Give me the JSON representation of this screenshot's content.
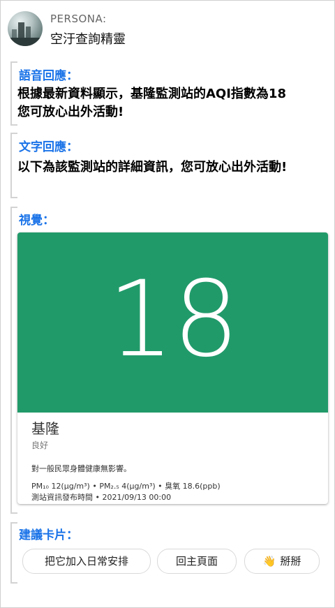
{
  "header": {
    "persona_label": "PERSONA:",
    "persona_name": "空汙查詢精靈"
  },
  "voice": {
    "title": "語音回應：",
    "line1": "根據最新資料顯示，基隆監測站的AQI指數為18",
    "line2": "您可放心出外活動!"
  },
  "text_reply": {
    "title": "文字回應：",
    "text": "以下為該監測站的詳細資訊，您可放心出外活動!"
  },
  "visual": {
    "title": "視覺：",
    "card": {
      "aqi": "18",
      "station": "基隆",
      "status": "良好",
      "health": "對一般民眾身體健康無影響。",
      "metrics": "PM₁₀ 12(μg/m³) • PM₂.₅ 4(μg/m³) • 臭氧 18.6(ppb)",
      "published": "測站資訊發布時間 • 2021/09/13 00:00"
    },
    "colors": {
      "aqi_band": "#219a6a"
    }
  },
  "suggestions": {
    "title": "建議卡片：",
    "chips": [
      "把它加入日常安排",
      "回主頁面",
      "掰掰"
    ],
    "chip3_icon": "waving-hand-icon"
  }
}
